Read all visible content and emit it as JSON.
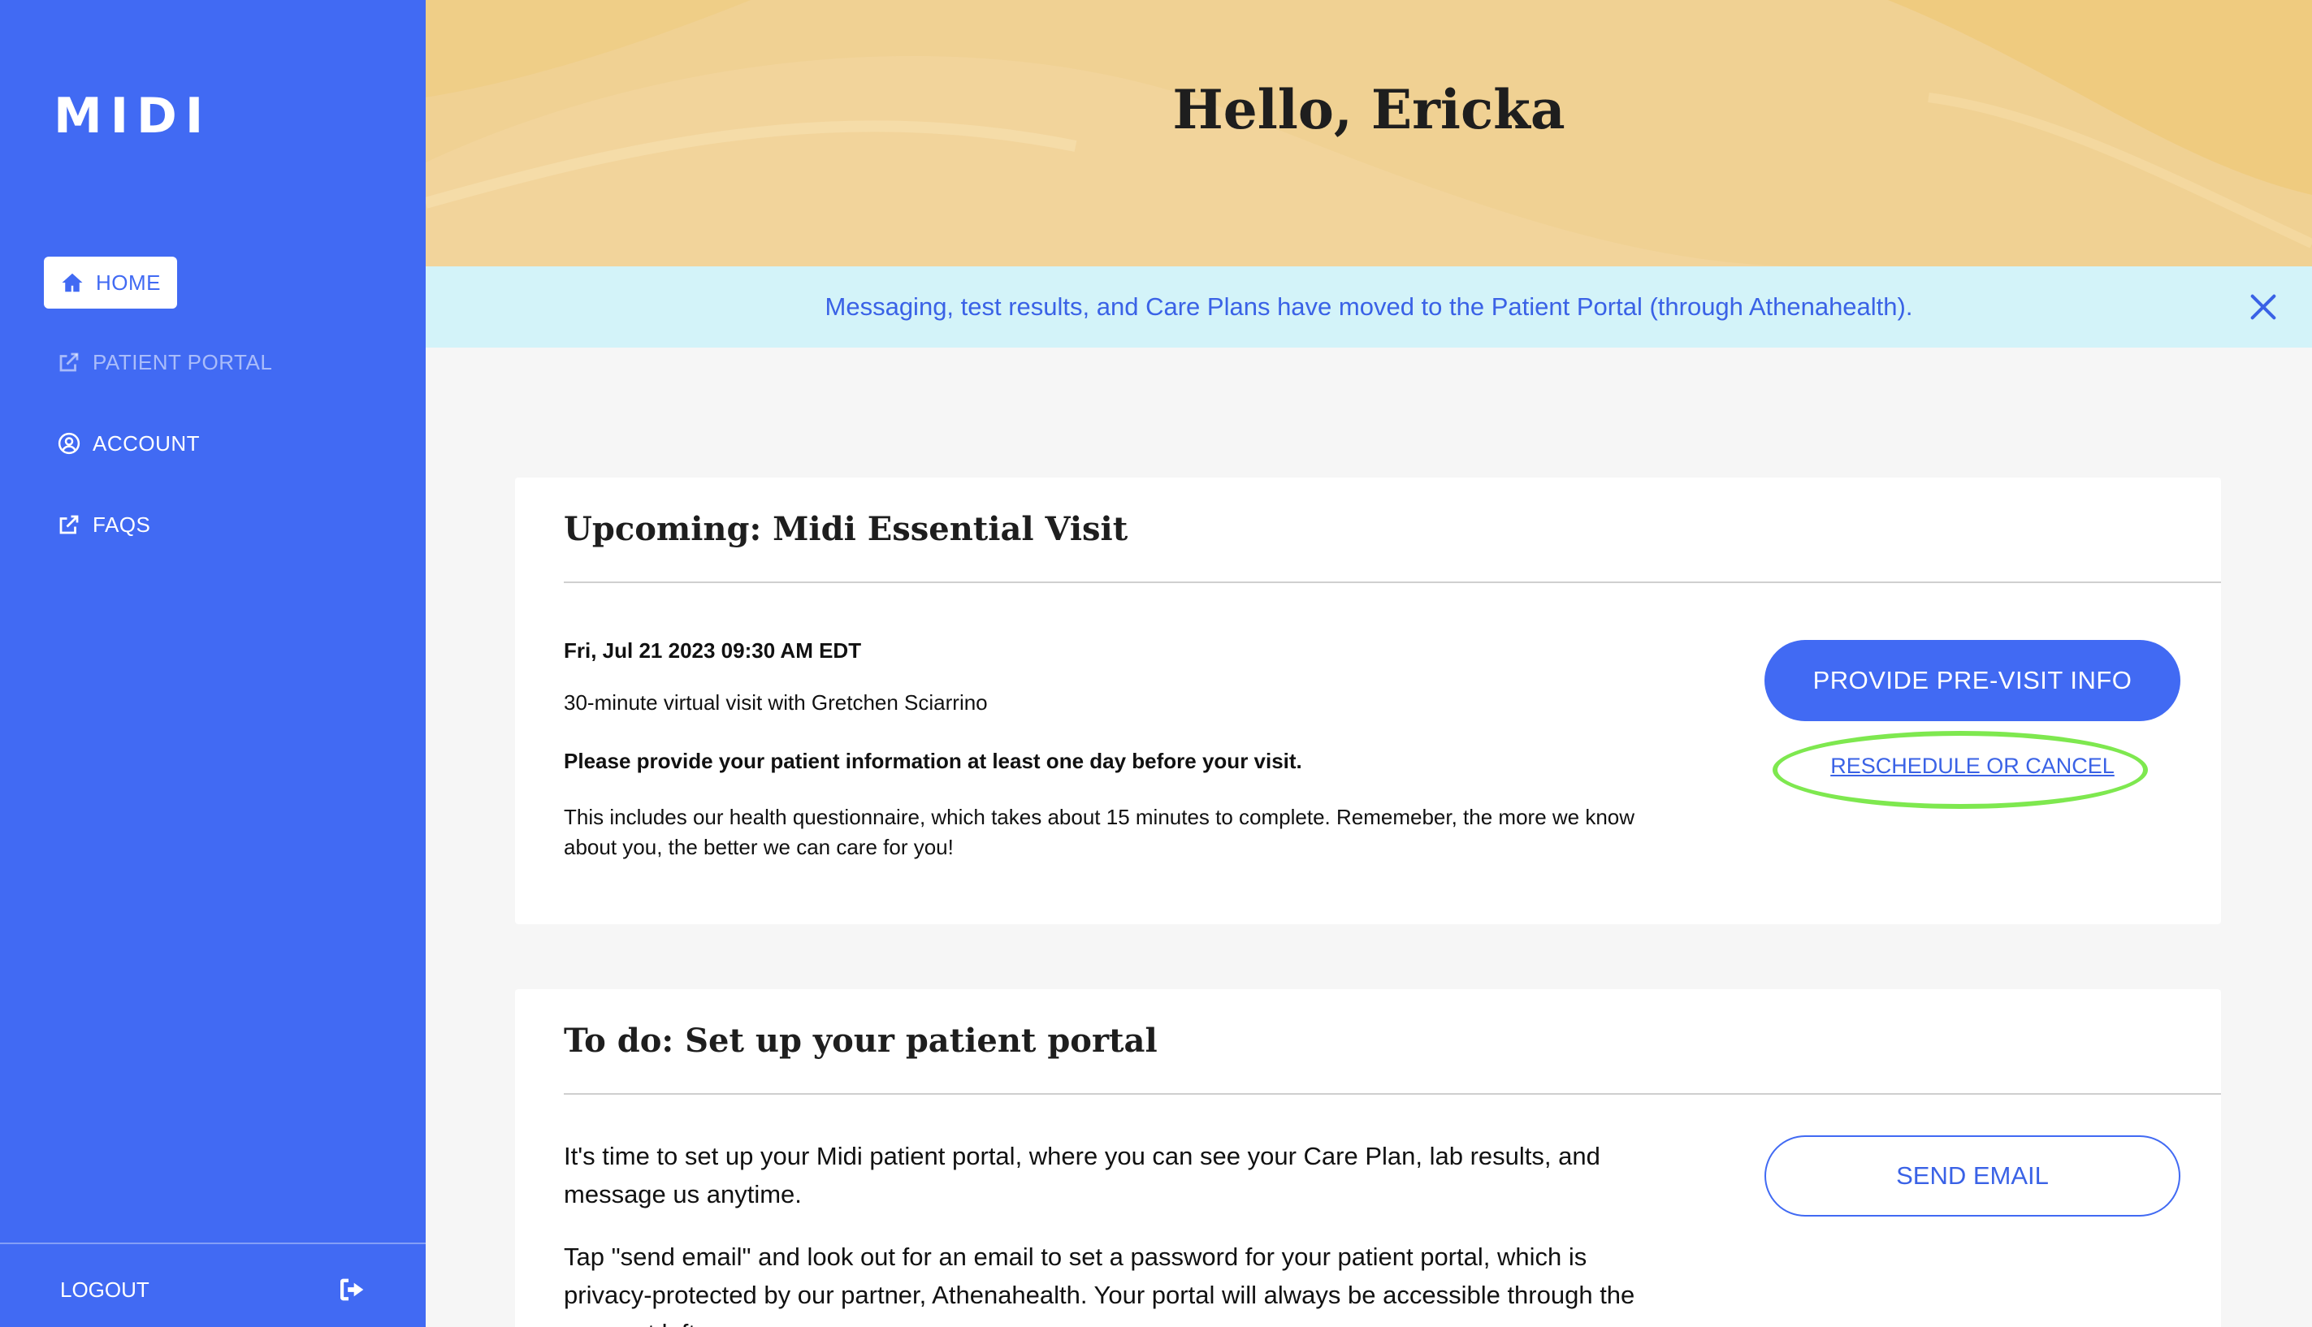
{
  "brand": {
    "logo": "MIDI",
    "primary_color": "#416af3",
    "accent_highlight": "#7ee84f"
  },
  "sidebar": {
    "items": [
      {
        "label": "HOME",
        "icon": "home-icon",
        "active": true
      },
      {
        "label": "PATIENT PORTAL",
        "icon": "external-link-icon",
        "disabled": true
      },
      {
        "label": "ACCOUNT",
        "icon": "user-circle-icon"
      },
      {
        "label": "FAQS",
        "icon": "external-link-icon"
      }
    ],
    "logout_label": "LOGOUT",
    "logout_icon": "logout-icon"
  },
  "header": {
    "greeting": "Hello, Ericka"
  },
  "banner": {
    "message": "Messaging, test results, and Care Plans have moved to the Patient Portal (through Athenahealth).",
    "close_icon": "close-icon"
  },
  "upcoming_visit": {
    "title": "Upcoming: Midi Essential Visit",
    "datetime": "Fri, Jul 21 2023 09:30 AM EDT",
    "description": "30-minute virtual visit with Gretchen Sciarrino",
    "notice": "Please provide your patient information at least one day before your visit.",
    "details": "This includes our health questionnaire, which takes about 15 minutes to complete. Rememeber, the more we know about you, the better we can care for you!",
    "primary_button": "PROVIDE PRE-VISIT INFO",
    "secondary_link": "RESCHEDULE OR CANCEL"
  },
  "todo_portal": {
    "title": "To do: Set up your patient portal",
    "body1": "It's time to set up your Midi patient portal, where you can see your Care Plan, lab results, and message us anytime.",
    "body2": "Tap \"send email\" and look out for an email to set a password for your patient portal, which is privacy-protected by our partner, Athenahealth. Your portal will always be accessible through the menu at left.",
    "button": "SEND EMAIL"
  }
}
